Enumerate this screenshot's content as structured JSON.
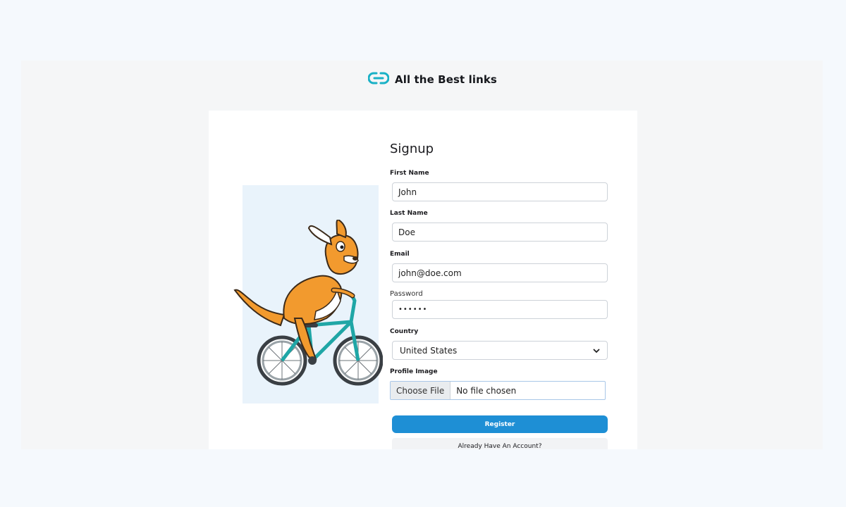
{
  "brand": {
    "name": "All the Best links",
    "logo_icon": "chain-link-icon",
    "accent_color": "#1ab1c6"
  },
  "form": {
    "title": "Signup",
    "first_name": {
      "label": "First Name",
      "value": "John"
    },
    "last_name": {
      "label": "Last Name",
      "value": "Doe"
    },
    "email": {
      "label": "Email",
      "value": "john@doe.com"
    },
    "password": {
      "label": "Password",
      "value": "••••••"
    },
    "country": {
      "label": "Country",
      "value": "United States"
    },
    "profile_image": {
      "label": "Profile Image",
      "button_label": "Choose File",
      "status": "No file chosen"
    },
    "register_label": "Register",
    "login_link_label": "Already Have An Account?"
  },
  "colors": {
    "primary": "#1e8fd5",
    "page_background": "#f5f9fd"
  },
  "illustration": {
    "icon": "kangaroo-on-bicycle-illustration"
  }
}
